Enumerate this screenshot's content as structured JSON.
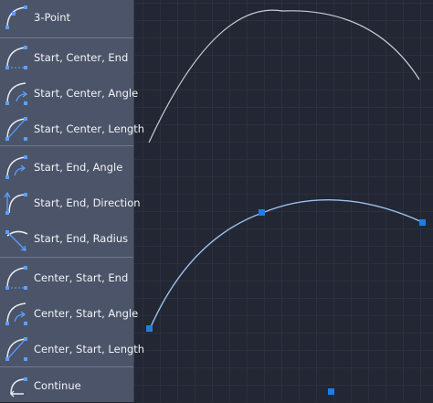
{
  "menu": {
    "items": [
      {
        "label": "3-Point",
        "icon": "arc-3-point-icon"
      },
      {
        "label": "Start, Center, End",
        "icon": "arc-start-center-end-icon"
      },
      {
        "label": "Start, Center, Angle",
        "icon": "arc-start-center-angle-icon"
      },
      {
        "label": "Start, Center, Length",
        "icon": "arc-start-center-length-icon"
      },
      {
        "label": "Start, End, Angle",
        "icon": "arc-start-end-angle-icon"
      },
      {
        "label": "Start, End, Direction",
        "icon": "arc-start-end-direction-icon"
      },
      {
        "label": "Start, End, Radius",
        "icon": "arc-start-end-radius-icon"
      },
      {
        "label": "Center, Start, End",
        "icon": "arc-center-start-end-icon"
      },
      {
        "label": "Center, Start, Angle",
        "icon": "arc-center-start-angle-icon"
      },
      {
        "label": "Center, Start, Length",
        "icon": "arc-center-start-length-icon"
      },
      {
        "label": "Continue",
        "icon": "arc-continue-icon"
      }
    ]
  },
  "colors": {
    "menu_bg": "#4b5468",
    "canvas_bg": "#222733",
    "accent_blue": "#1e7de6",
    "arc_preview": "#9fc0ee",
    "arc_reference": "#c8ccd6"
  }
}
